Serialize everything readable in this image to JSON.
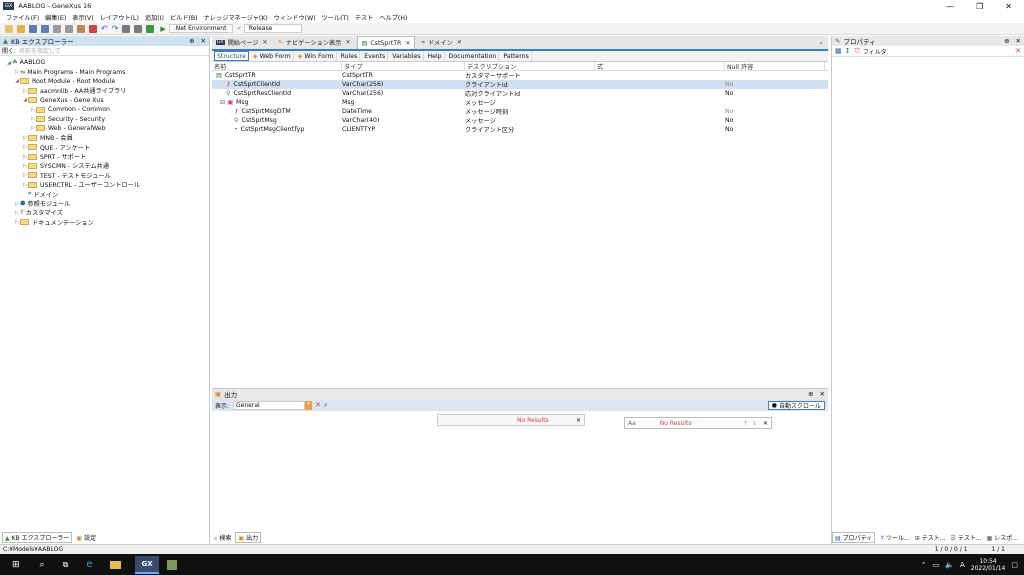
{
  "window": {
    "title": "AABLOG - GeneXus 16",
    "app_badge": "GX"
  },
  "menu": [
    "ファイル(F)",
    "編集(E)",
    "表示(V)",
    "レイアウト(L)",
    "追加(I)",
    "ビルド(B)",
    "ナレッジマネージャ(K)",
    "ウィンドウ(W)",
    "ツール(T)",
    "テスト",
    "ヘルプ(H)"
  ],
  "toolbar": {
    "environment": ".Net Environment",
    "config": "Release"
  },
  "kb_explorer": {
    "title": "KB エクスプローラー",
    "open_label": "開く:",
    "open_placeholder": "名前を指定して",
    "items": [
      {
        "label": "AABLOG",
        "indent": 0
      },
      {
        "label": "Main Programs - Main Programs",
        "indent": 1
      },
      {
        "label": "Root Module - Root Module",
        "indent": 1
      },
      {
        "label": "aacmnlib - AA共通ライブラリ",
        "indent": 2
      },
      {
        "label": "GeneXus - Gene Xus",
        "indent": 2
      },
      {
        "label": "Common - Common",
        "indent": 3
      },
      {
        "label": "Security - Security",
        "indent": 3
      },
      {
        "label": "Web - GeneralWeb",
        "indent": 3
      },
      {
        "label": "MNB - 会員",
        "indent": 2
      },
      {
        "label": "QUE - アンケート",
        "indent": 2
      },
      {
        "label": "SPRT - サポート",
        "indent": 2
      },
      {
        "label": "SYSCMN - システム共通",
        "indent": 2
      },
      {
        "label": "TEST - テストモジュール",
        "indent": 2
      },
      {
        "label": "USERCTRL - ユーザーコントロール",
        "indent": 2
      },
      {
        "label": "ドメイン",
        "indent": 2
      },
      {
        "label": "参照モジュール",
        "indent": 1
      },
      {
        "label": "カスタマイズ",
        "indent": 1
      },
      {
        "label": "ドキュメンテーション",
        "indent": 1
      }
    ]
  },
  "tabs": [
    {
      "label": "開始ページ",
      "active": false
    },
    {
      "label": "ナビゲーション表示",
      "active": false
    },
    {
      "label": "CstSprtTR",
      "active": true
    },
    {
      "label": "ドメイン",
      "active": false
    }
  ],
  "subtabs": [
    "Structure",
    "Web Form",
    "Win Form",
    "Rules",
    "Events",
    "Variables",
    "Help",
    "Documentation",
    "Patterns"
  ],
  "grid": {
    "headers": [
      "名前",
      "タイプ",
      "デスクリプション",
      "式",
      "Null 許容"
    ],
    "rows": [
      {
        "name": "CstSprtTR",
        "type": "CstSprtTR",
        "desc": "カスタマーサポート",
        "formula": "",
        "null": "",
        "indent": 0
      },
      {
        "name": "CstSprtClientId",
        "type": "VarChar(256)",
        "desc": "クライアントId",
        "formula": "",
        "null": "No",
        "indent": 1
      },
      {
        "name": "CstSprtResClientId",
        "type": "VarChar(256)",
        "desc": "応対クライアントId",
        "formula": "",
        "null": "No",
        "indent": 1
      },
      {
        "name": "Msg",
        "type": "Msg",
        "desc": "メッセージ",
        "formula": "",
        "null": "",
        "indent": 1
      },
      {
        "name": "CstSprtMsgDTM",
        "type": "DateTime",
        "desc": "メッセージ時刻",
        "formula": "",
        "null": "No",
        "indent": 2
      },
      {
        "name": "CstSprtMsg",
        "type": "VarChar(40)",
        "desc": "メッセージ",
        "formula": "",
        "null": "No",
        "indent": 2
      },
      {
        "name": "CstSprtMsgClientTyp",
        "type": "CLIENTTYP",
        "desc": "クライアント区分",
        "formula": "",
        "null": "No",
        "indent": 2
      }
    ]
  },
  "output": {
    "title": "出力",
    "show_label": "表示:",
    "show_value": "General",
    "autoscroll": "自動スクロール",
    "find_no_results": "No Results",
    "find_no_results2": "No Results"
  },
  "properties": {
    "title": "プロパティ",
    "filter": "フィルタ"
  },
  "bottom_tabs_left": [
    "KB エクスプローラー",
    "設定"
  ],
  "bottom_tabs_center": [
    "検索",
    "出力"
  ],
  "bottom_tabs_right": [
    "プロパティ",
    "ツール...",
    "テスト...",
    "テスト...",
    "レスポ..."
  ],
  "status": {
    "path": "C:¥Models¥AABLOG",
    "right1": "1 / 0 / 0 / 1",
    "right2": "1 / 1"
  },
  "taskbar": {
    "time": "10:54",
    "date": "2022/01/14",
    "ime": "A"
  }
}
